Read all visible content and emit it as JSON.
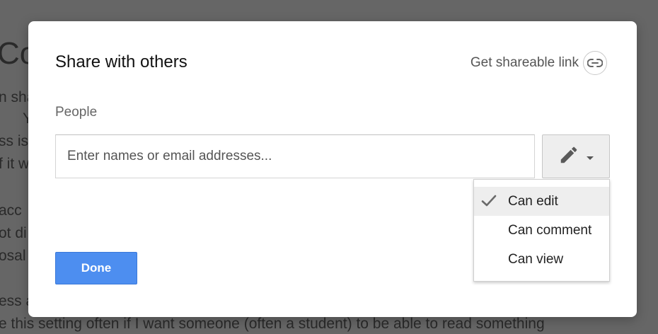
{
  "background_document": {
    "heading": "Co",
    "lines": [
      "n sha",
      "You",
      "ss is",
      "f it w",
      "acc",
      "ot di",
      "osal",
      "ess a",
      "e this setting often if I want someone (often a student) to be able to read something"
    ]
  },
  "dialog": {
    "title": "Share with others",
    "share_link_label": "Get shareable link",
    "people_label": "People",
    "people_input_placeholder": "Enter names or email addresses...",
    "people_input_value": "",
    "permission_button_icon": "pencil-icon",
    "permission_menu": {
      "items": [
        {
          "label": "Can edit",
          "selected": true
        },
        {
          "label": "Can comment",
          "selected": false
        },
        {
          "label": "Can view",
          "selected": false
        }
      ]
    },
    "done_label": "Done"
  },
  "colors": {
    "overlay": "#666666",
    "primary_button": "#4d8ef0",
    "menu_selected_bg": "#eeeeee"
  }
}
